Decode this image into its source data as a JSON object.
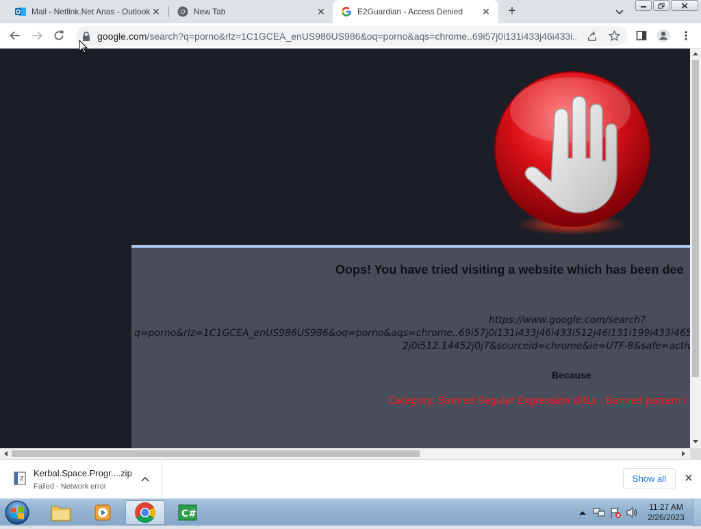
{
  "browser": {
    "tabs": [
      {
        "label": "Mail - Netlink.Net Anas - Outlook",
        "icon": "outlook-icon",
        "active": false
      },
      {
        "label": "New Tab",
        "icon": "chrome-icon",
        "active": false
      },
      {
        "label": "E2Guardian - Access Denied",
        "icon": "google-icon",
        "active": true
      }
    ],
    "address": {
      "host": "google.com",
      "rest": "/search?q=porno&rlz=1C1GCEA_enUS986US986&oq=porno&aqs=chrome..69i57j0i131i433j46i433i..."
    }
  },
  "page": {
    "title": "Oops! You have tried visiting a website which has been dee",
    "url_lines": [
      "https://www.google.com/search?",
      "q=porno&rlz=1C1GCEA_enUS986US986&oq=porno&aqs=chrome..69i57j0i131i433j46i433i512j46i131i199i433i465i5",
      "2j0i512.14452j0j7&sourceid=chrome&ie=UTF-8&safe=activ"
    ],
    "because": "Because",
    "category": "Category: Banned Regular Expression URLs : Banned pattern i"
  },
  "downloads": {
    "file_name": "Kerbal.Space.Progr....zip",
    "status": "Failed - Network error",
    "show_all": "Show all"
  },
  "taskbar": {
    "time": "11:27 AM",
    "date": "2/26/2023"
  },
  "colors": {
    "content_bg": "#1b1e27",
    "panel_bg": "#484c5b",
    "panel_border": "#a9c8ec",
    "category_text": "#ff1a1a",
    "stop_red": "#e0121a"
  }
}
